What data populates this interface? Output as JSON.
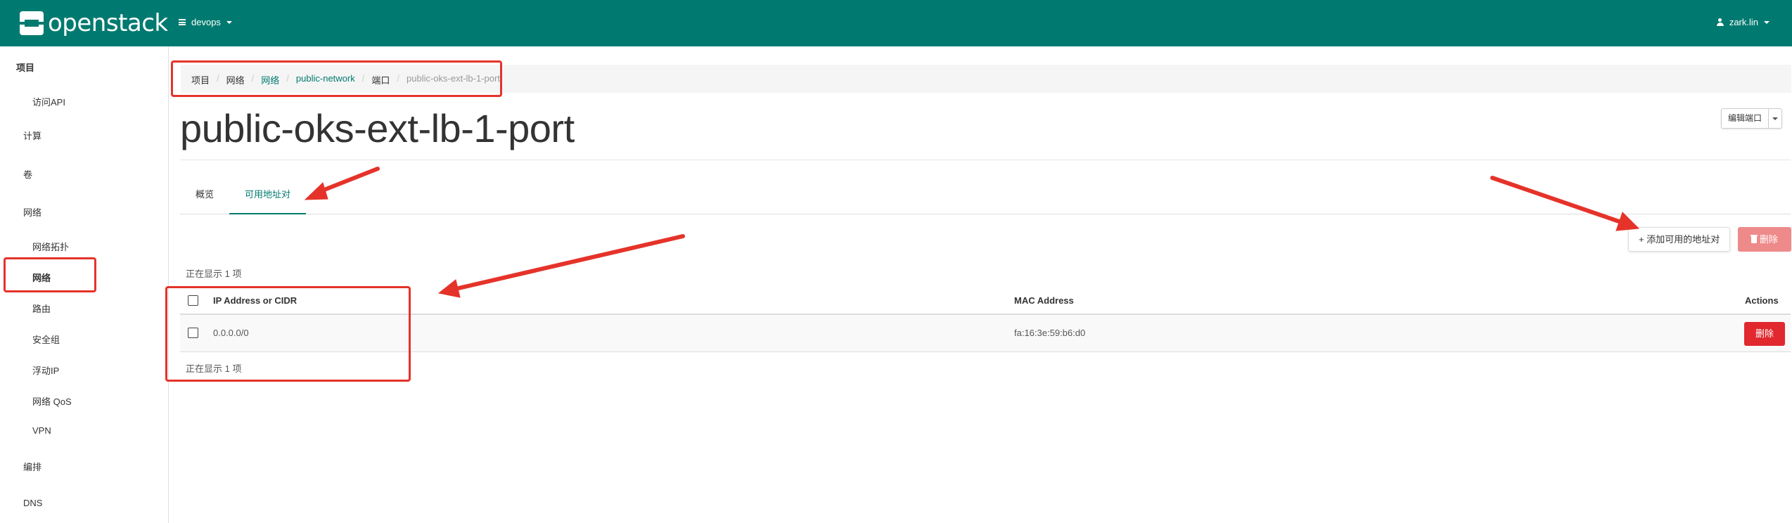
{
  "header": {
    "logo_text": "openstack",
    "project": "devops",
    "user": "zark.lin"
  },
  "sidebar": {
    "items": [
      {
        "label": "项目"
      },
      {
        "label": "访问API"
      },
      {
        "label": "计算"
      },
      {
        "label": "卷"
      },
      {
        "label": "网络"
      },
      {
        "label": "网络拓扑"
      },
      {
        "label": "网络"
      },
      {
        "label": "路由"
      },
      {
        "label": "安全组"
      },
      {
        "label": "浮动IP"
      },
      {
        "label": "网络 QoS"
      },
      {
        "label": "VPN"
      },
      {
        "label": "编排"
      },
      {
        "label": "DNS"
      }
    ]
  },
  "breadcrumb": [
    "项目",
    "网络",
    "网络",
    "public-network",
    "端口",
    "public-oks-ext-lb-1-port"
  ],
  "page": {
    "title": "public-oks-ext-lb-1-port",
    "edit_button": "编辑端口"
  },
  "tabs": [
    "概览",
    "可用地址对"
  ],
  "actions": {
    "add_label": "+ 添加可用的地址对",
    "delete_label": "删除"
  },
  "table": {
    "count_text": "正在显示 1 项",
    "columns": [
      "IP Address or CIDR",
      "MAC Address",
      "Actions"
    ],
    "rows": [
      {
        "ip": "0.0.0.0/0",
        "mac": "fa:16:3e:59:b6:d0",
        "action": "删除"
      }
    ]
  },
  "colors": {
    "brand": "#007a70",
    "danger": "#e0282e",
    "annotation": "#e5332a"
  }
}
